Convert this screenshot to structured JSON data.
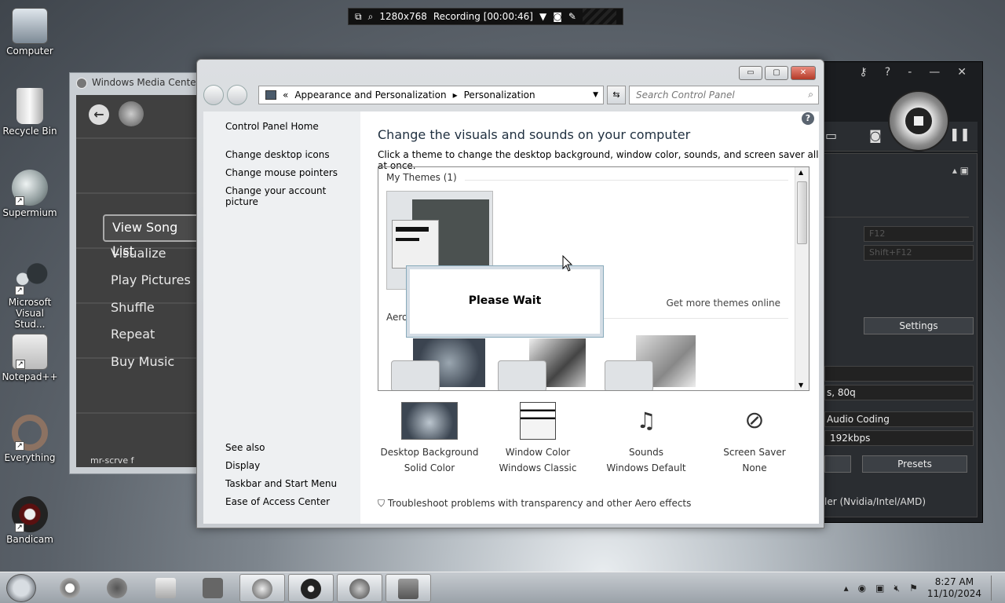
{
  "desktop": {
    "icons": [
      {
        "label": "Computer"
      },
      {
        "label": "Recycle Bin"
      },
      {
        "label": "Supermium"
      },
      {
        "label": "Microsoft Visual Stud..."
      },
      {
        "label": "Notepad++"
      },
      {
        "label": "Everything"
      },
      {
        "label": "Bandicam"
      }
    ]
  },
  "recording_bar": {
    "resolution": "1280x768",
    "status": "Recording [00:00:46]"
  },
  "media_center": {
    "title": "Windows Media Center",
    "menu": [
      "View Song List",
      "Visualize",
      "Play Pictures",
      "Shuffle",
      "Repeat",
      "Buy Music"
    ],
    "selected": "View Song List",
    "bottom_text": "mr-scrve f"
  },
  "control_panel": {
    "breadcrumb": {
      "prefix": "«",
      "parent": "Appearance and Personalization",
      "current": "Personalization"
    },
    "search_placeholder": "Search Control Panel",
    "sidebar": {
      "home": "Control Panel Home",
      "links": [
        "Change desktop icons",
        "Change mouse pointers",
        "Change your account picture"
      ],
      "see_also_label": "See also",
      "see_also": [
        "Display",
        "Taskbar and Start Menu",
        "Ease of Access Center"
      ]
    },
    "heading": "Change the visuals and sounds on your computer",
    "subheading": "Click a theme to change the desktop background, window color, sounds, and screen saver all at once.",
    "my_themes_label": "My Themes (1)",
    "get_more_link": "Get more themes online",
    "aero_label": "Aero",
    "please_wait": "Please Wait",
    "settings": [
      {
        "title": "Desktop Background",
        "value": "Solid Color"
      },
      {
        "title": "Window Color",
        "value": "Windows Classic"
      },
      {
        "title": "Sounds",
        "value": "Windows Default"
      },
      {
        "title": "Screen Saver",
        "value": "None"
      }
    ],
    "troubleshoot": "Troubleshoot problems with transparency and other Aero effects"
  },
  "bandicam": {
    "hotkey1": "F12",
    "hotkey2": "Shift+F12",
    "settings_button": "Settings",
    "format_row": "s, 80q",
    "audio_codec": "Audio Coding",
    "audio_bitrate": "192kbps",
    "presets_button": "Presets",
    "encoder": "ler (Nvidia/Intel/AMD)"
  },
  "taskbar": {
    "time": "8:27 AM",
    "date": "11/10/2024"
  }
}
